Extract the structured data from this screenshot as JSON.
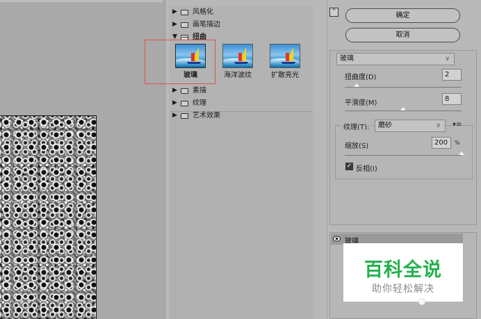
{
  "gallery": {
    "categories": [
      {
        "label": "风格化",
        "expanded": false
      },
      {
        "label": "画笔描边",
        "expanded": false
      },
      {
        "label": "扭曲",
        "expanded": true
      },
      {
        "label": "素描",
        "expanded": false
      },
      {
        "label": "纹理",
        "expanded": false
      },
      {
        "label": "艺术效果",
        "expanded": false
      }
    ],
    "thumbnails": [
      {
        "label": "玻璃",
        "selected": true
      },
      {
        "label": "海洋波纹",
        "selected": false
      },
      {
        "label": "扩散亮光",
        "selected": false
      }
    ]
  },
  "actions": {
    "collapse_icon": "⌃",
    "ok_label": "确定",
    "cancel_label": "取消"
  },
  "settings": {
    "filter_select": "玻璃",
    "distortion": {
      "label": "扭曲度(D)",
      "value": "2",
      "slider_fraction": 0.1
    },
    "smoothness": {
      "label": "平滑度(M)",
      "value": "8",
      "slider_fraction": 0.5
    },
    "texture": {
      "label": "纹理(T):",
      "selected": "磨砂",
      "menu_icon": "▾≡",
      "scale": {
        "label": "缩放(S)",
        "value": "200",
        "unit": "%",
        "slider_fraction": 1.0
      },
      "invert": {
        "label": "反相(I)",
        "checked": true,
        "check_glyph": "✓"
      }
    }
  },
  "layers": {
    "items": [
      {
        "label": "玻璃",
        "visible": true
      }
    ]
  },
  "watermark": {
    "title": "百科全说",
    "subtitle": "助你轻松解决"
  },
  "colors": {
    "watermark_green": "#23b14d",
    "selection_red": "#d9534f"
  }
}
